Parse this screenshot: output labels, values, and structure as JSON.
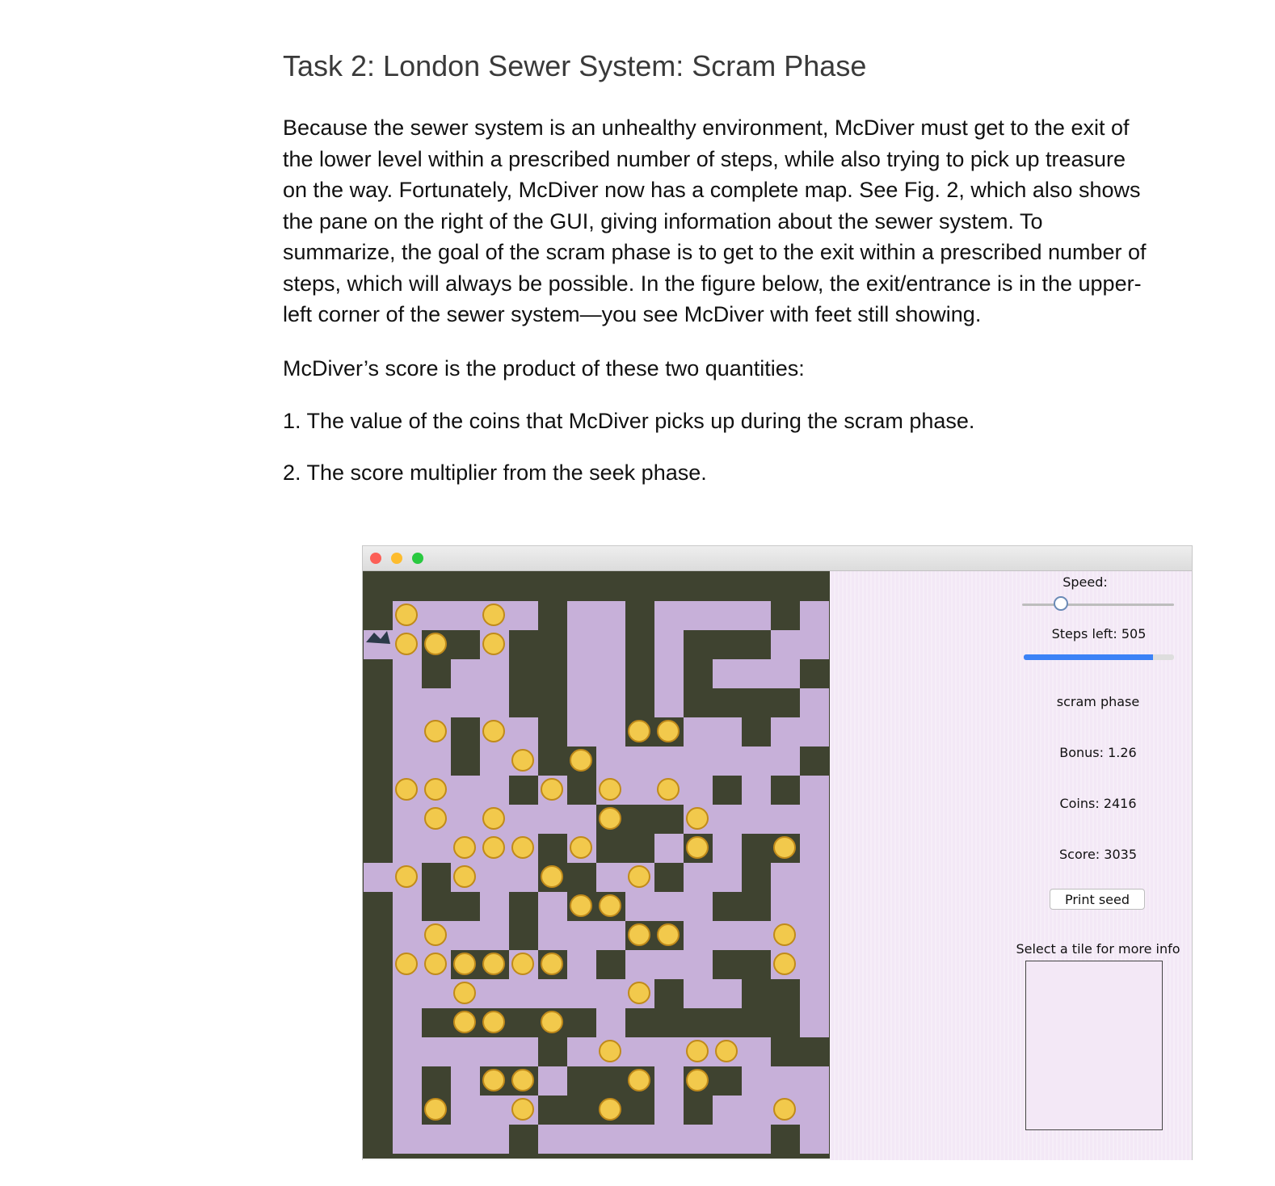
{
  "document": {
    "heading": "Task 2: London Sewer System: Scram Phase",
    "paragraph1": "Because the sewer system is an unhealthy environment, McDiver must get to the exit of the lower level within a prescribed number of steps, while also trying to pick up treasure on the way. Fortunately, McDiver now has a complete map. See Fig. 2, which also shows the pane on the right of the GUI, giving information about the sewer system. To summarize, the goal of the scram phase is to get to the exit within a prescribed number of steps, which will always be possible. In the figure below, the exit/entrance is in the upper-left corner of the sewer system—you see McDiver with feet still showing.",
    "paragraph2": "McDiver’s score is the product of these two quantities:",
    "list": [
      "1. The value of the coins that McDiver picks up during the scram phase.",
      "2. The score multiplier from the seek phase."
    ]
  },
  "gui": {
    "speed_label": "Speed:",
    "steps_left_label": "Steps left: 505",
    "steps_remaining_fraction": 0.86,
    "phase_label": "scram phase",
    "bonus_label": "Bonus: 1.26",
    "coins_label": "Coins: 2416",
    "score_label": "Score: 3035",
    "print_seed_button": "Print seed",
    "select_tile_label": "Select a tile for more info",
    "colors": {
      "wall": "#3f4330",
      "floor": "#c7b0d9",
      "coin": "#f2c94c",
      "progress": "#3b82f6",
      "pane_background": "#f3e8f6"
    }
  }
}
